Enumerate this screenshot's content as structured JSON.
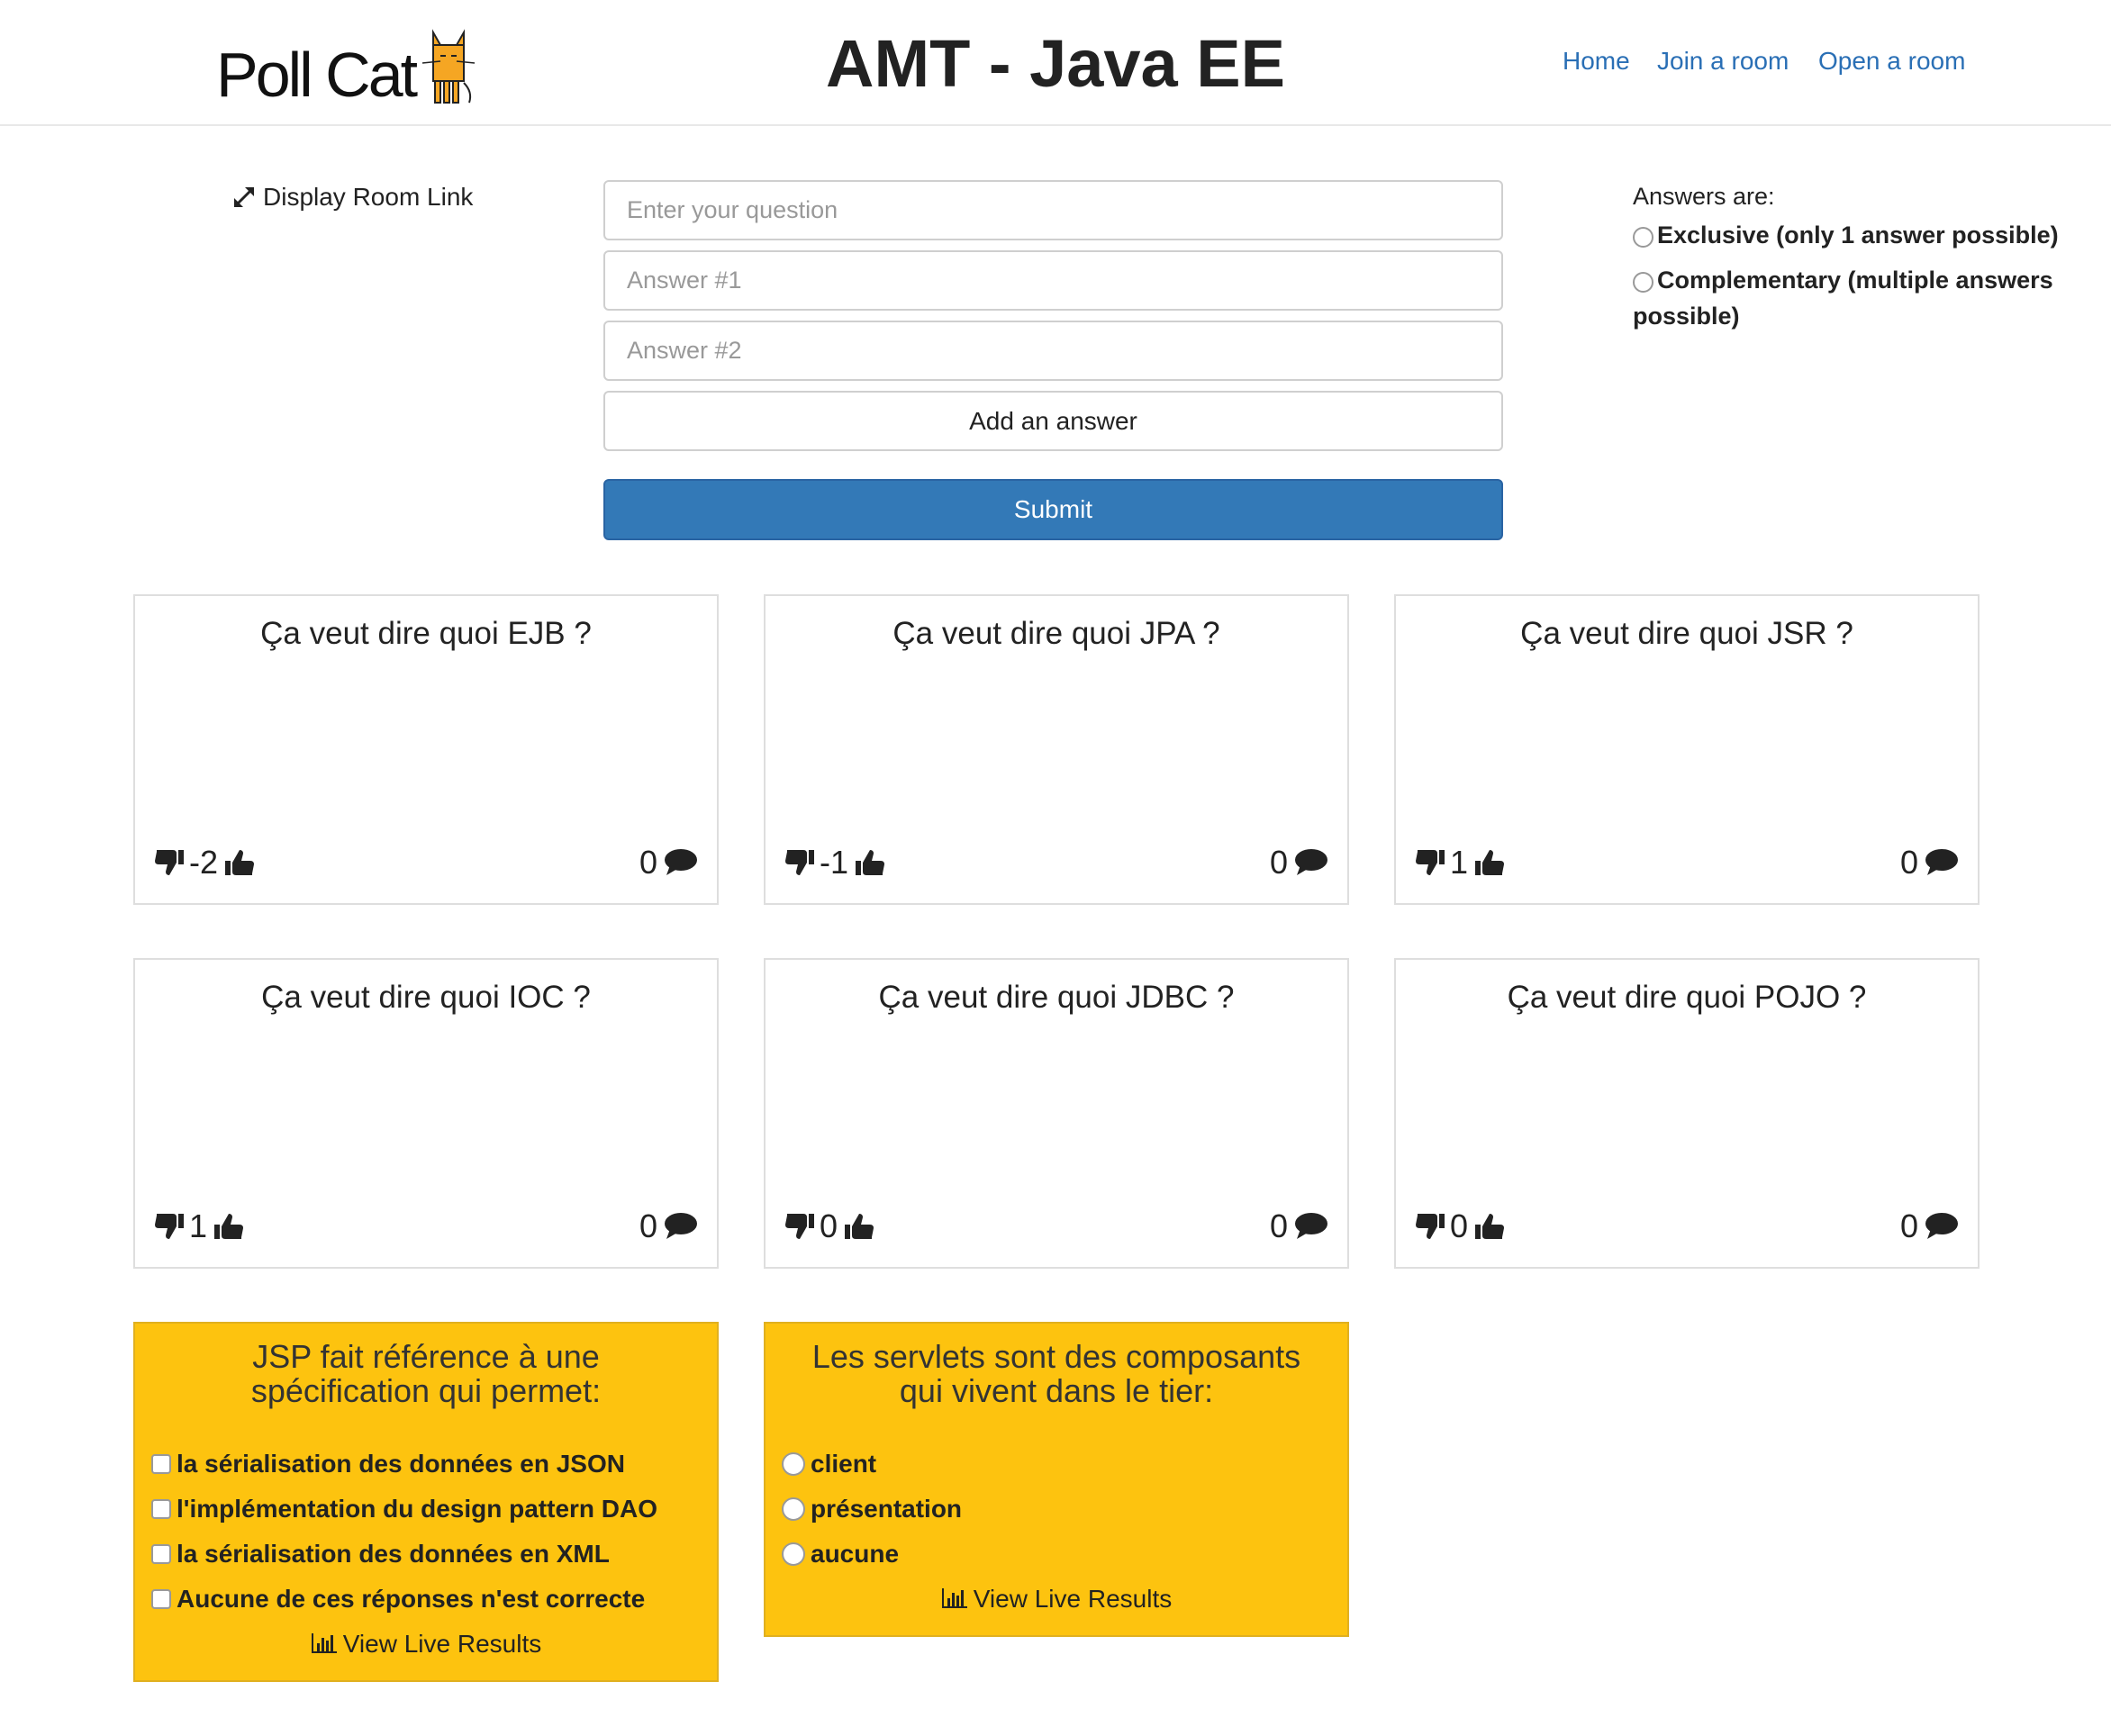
{
  "header": {
    "logo_text": "Poll Cat",
    "title": "AMT - Java EE",
    "nav": [
      "Home",
      "Join a room",
      "Open a room"
    ]
  },
  "room_link": "Display Room Link",
  "form": {
    "question_placeholder": "Enter your question",
    "answer1_placeholder": "Answer #1",
    "answer2_placeholder": "Answer #2",
    "add_answer": "Add an answer",
    "submit": "Submit"
  },
  "answer_type": {
    "label": "Answers are:",
    "options": [
      "Exclusive (only 1 answer possible)",
      "Complementary (multiple answers possible)"
    ]
  },
  "questions": [
    {
      "title": "Ça veut dire quoi EJB ?",
      "score": "-2",
      "comments": "0"
    },
    {
      "title": "Ça veut dire quoi JPA ?",
      "score": "-1",
      "comments": "0"
    },
    {
      "title": "Ça veut dire quoi JSR ?",
      "score": "1",
      "comments": "0"
    },
    {
      "title": "Ça veut dire quoi IOC ?",
      "score": "1",
      "comments": "0"
    },
    {
      "title": "Ça veut dire quoi JDBC ?",
      "score": "0",
      "comments": "0"
    },
    {
      "title": "Ça veut dire quoi POJO ?",
      "score": "0",
      "comments": "0"
    }
  ],
  "polls": [
    {
      "title_line1": "JSP fait référence à une",
      "title_line2": "spécification qui permet:",
      "type": "checkbox",
      "options": [
        "la sérialisation des données en JSON",
        "l'implémentation du design pattern DAO",
        "la sérialisation des données en XML",
        "Aucune de ces réponses n'est correcte"
      ],
      "view_results": "View Live Results"
    },
    {
      "title_line1": "Les servlets sont des composants",
      "title_line2": "qui vivent dans le tier:",
      "type": "radio",
      "options": [
        "client",
        "présentation",
        "aucune"
      ],
      "view_results": "View Live Results"
    }
  ],
  "colors": {
    "link": "#2a6fb5",
    "primary": "#3379b7",
    "poll_bg": "#fdc30f",
    "cat": "#f5a623"
  },
  "icons": [
    "cat-logo-icon",
    "expand-icon",
    "thumbs-down-icon",
    "thumbs-up-icon",
    "comment-icon",
    "bar-chart-icon"
  ]
}
